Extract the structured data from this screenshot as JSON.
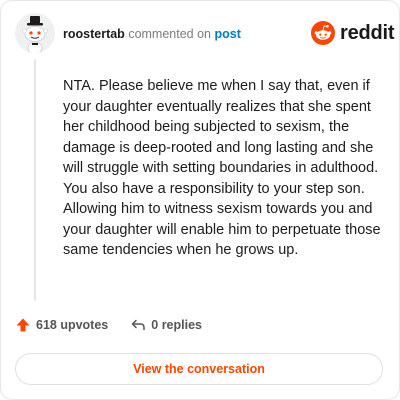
{
  "header": {
    "username": "roostertab",
    "commented_on": "commented on",
    "post_link": "post"
  },
  "brand": {
    "name": "reddit",
    "color": "#ff4500",
    "icon": "reddit-snoo-icon"
  },
  "comment": {
    "text": "NTA. Please believe me when I say that, even if your daughter eventually realizes that she spent her childhood being subjected to sexism, the damage is deep-rooted and long lasting and she will struggle with setting boundaries in adulthood. You also have a responsibility to your step son. Allowing him to witness sexism towards you and your daughter will enable him to perpetuate those same tendencies when he grows up."
  },
  "actions": {
    "upvotes": "618 upvotes",
    "upvote_icon": "upvote-arrow-icon",
    "replies": "0 replies",
    "reply_icon": "reply-arrow-icon"
  },
  "cta": {
    "label": "View the conversation"
  },
  "colors": {
    "accent": "#ff4500",
    "link": "#0079d3"
  }
}
